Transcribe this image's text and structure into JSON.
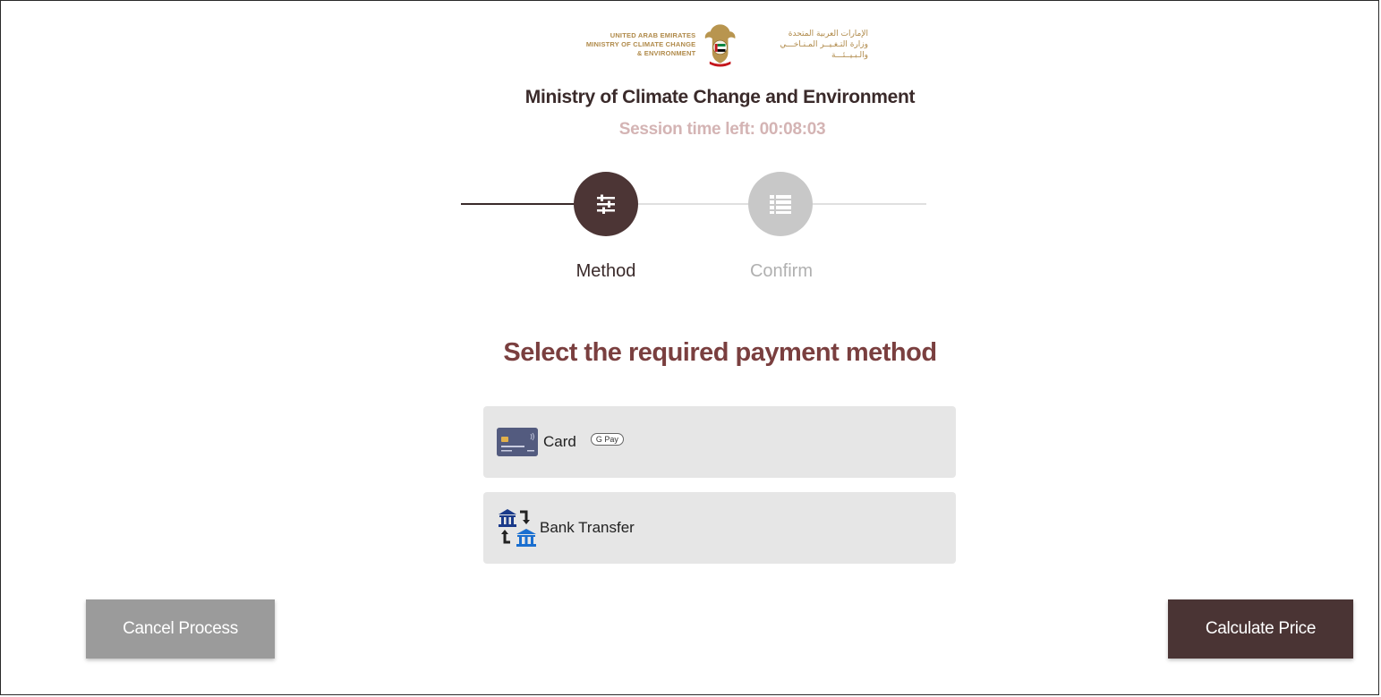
{
  "header": {
    "logo_en_lines": [
      "UNITED ARAB EMIRATES",
      "MINISTRY OF CLIMATE CHANGE",
      "& ENVIRONMENT"
    ],
    "logo_ar_lines": [
      "الإمارات العربية المتحدة",
      "وزارة التـغـيــر المـنـاخـــي",
      "والـبـيــئـــة"
    ],
    "org_name": "Ministry of Climate Change and Environment",
    "session_label": "Session time left:",
    "session_time": "00:08:03"
  },
  "stepper": {
    "steps": [
      {
        "label": "Method",
        "icon": "sliders-icon",
        "state": "active"
      },
      {
        "label": "Confirm",
        "icon": "list-icon",
        "state": "inactive"
      }
    ]
  },
  "main": {
    "title": "Select the required payment method",
    "options": [
      {
        "label": "Card",
        "icon": "credit-card-icon",
        "badge": "G Pay"
      },
      {
        "label": "Bank Transfer",
        "icon": "bank-transfer-icon"
      }
    ]
  },
  "footer": {
    "cancel_label": "Cancel Process",
    "calculate_label": "Calculate Price"
  },
  "colors": {
    "primary": "#4a3434",
    "title": "#7a3f3f",
    "session": "#d4b4b4",
    "option_bg": "#e6e6e6",
    "cancel_bg": "#9b9b9b"
  }
}
